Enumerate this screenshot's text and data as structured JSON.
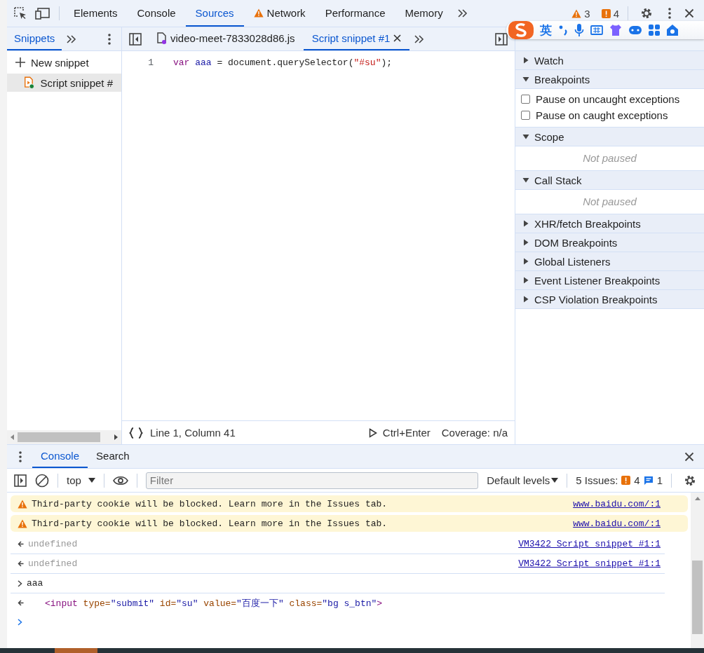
{
  "main_tabs": [
    {
      "label": "Elements",
      "selected": false,
      "warning": false
    },
    {
      "label": "Console",
      "selected": false,
      "warning": false
    },
    {
      "label": "Sources",
      "selected": true,
      "warning": false
    },
    {
      "label": "Network",
      "selected": false,
      "warning": true
    },
    {
      "label": "Performance",
      "selected": false,
      "warning": false
    },
    {
      "label": "Memory",
      "selected": false,
      "warning": false
    }
  ],
  "issue_counts": {
    "warnings": "3",
    "errors": "4"
  },
  "ime_bar": {
    "mode": "英"
  },
  "navigator": {
    "tabs": [
      {
        "label": "Snippets",
        "selected": true
      }
    ],
    "new_snippet": "New snippet",
    "items": [
      {
        "label": "Script snippet #",
        "selected": true
      }
    ]
  },
  "editor": {
    "tabs": [
      {
        "label": "video-meet-7833028d86.js",
        "selected": false,
        "closable": false
      },
      {
        "label": "Script snippet #1",
        "selected": true,
        "closable": true
      }
    ],
    "lines": [
      {
        "number": "1",
        "tokens": [
          {
            "kind": "keyword",
            "text": "var"
          },
          {
            "kind": "variable",
            "text": " aaa"
          },
          {
            "kind": "plain",
            "text": " = document.querySelector("
          },
          {
            "kind": "string",
            "text": "\"#su\""
          },
          {
            "kind": "plain",
            "text": ");"
          }
        ]
      }
    ],
    "status": {
      "position": "Line 1, Column 41",
      "run": "Ctrl+Enter",
      "coverage": "Coverage: n/a"
    }
  },
  "debugger": {
    "sections": [
      {
        "title": "Watch",
        "expanded": false
      },
      {
        "title": "Breakpoints",
        "expanded": true,
        "checkboxes": [
          {
            "label": "Pause on uncaught exceptions",
            "checked": false
          },
          {
            "label": "Pause on caught exceptions",
            "checked": false
          }
        ]
      },
      {
        "title": "Scope",
        "expanded": true,
        "message": "Not paused"
      },
      {
        "title": "Call Stack",
        "expanded": true,
        "message": "Not paused"
      },
      {
        "title": "XHR/fetch Breakpoints",
        "expanded": false
      },
      {
        "title": "DOM Breakpoints",
        "expanded": false
      },
      {
        "title": "Global Listeners",
        "expanded": false
      },
      {
        "title": "Event Listener Breakpoints",
        "expanded": false
      },
      {
        "title": "CSP Violation Breakpoints",
        "expanded": false
      }
    ]
  },
  "drawer": {
    "tabs": [
      {
        "label": "Console",
        "selected": true
      },
      {
        "label": "Search",
        "selected": false
      }
    ],
    "context": "top",
    "filter_placeholder": "Filter",
    "levels": "Default levels",
    "issues": {
      "label": "5 Issues:",
      "errors": "4",
      "info": "1"
    },
    "messages": [
      {
        "kind": "warning",
        "text": "Third-party cookie will be blocked. Learn more in the Issues tab.",
        "source": "www.baidu.com/:1"
      },
      {
        "kind": "warning",
        "text": "Third-party cookie will be blocked. Learn more in the Issues tab.",
        "source": "www.baidu.com/:1"
      },
      {
        "kind": "result",
        "text": "undefined",
        "source": "VM3422 Script snippet #1:1"
      },
      {
        "kind": "result",
        "text": "undefined",
        "source": "VM3422 Script snippet #1:1"
      },
      {
        "kind": "input",
        "text": "aaa"
      },
      {
        "kind": "element",
        "tokens": [
          {
            "kind": "tag",
            "text": "<input"
          },
          {
            "kind": "attr",
            "text": " type="
          },
          {
            "kind": "value",
            "text": "\"submit\""
          },
          {
            "kind": "attr",
            "text": " id="
          },
          {
            "kind": "value",
            "text": "\"su\""
          },
          {
            "kind": "attr",
            "text": " value="
          },
          {
            "kind": "value",
            "text": "\"百度一下\""
          },
          {
            "kind": "attr",
            "text": " class="
          },
          {
            "kind": "value",
            "text": "\"bg s_btn\""
          },
          {
            "kind": "tag",
            "text": ">"
          }
        ]
      },
      {
        "kind": "prompt"
      }
    ]
  }
}
